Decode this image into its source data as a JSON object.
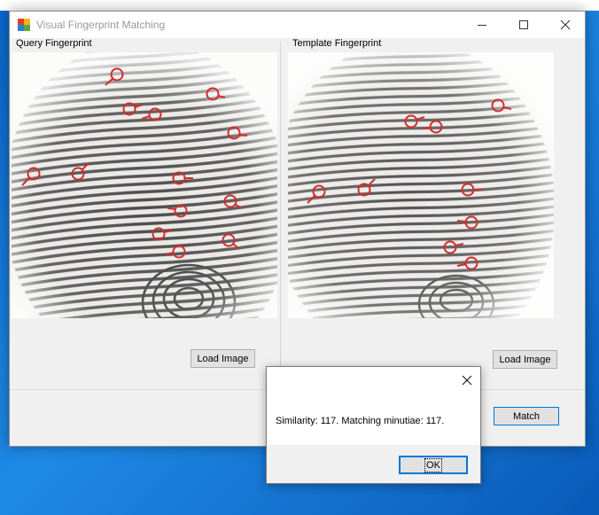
{
  "window": {
    "title": "Visual Fingerprint Matching",
    "icon": "app-icon",
    "controls": [
      "minimize-icon",
      "maximize-icon",
      "close-icon"
    ]
  },
  "query_panel": {
    "label": "Query Fingerprint",
    "load_label": "Load Image"
  },
  "template_panel": {
    "label": "Template Fingerprint",
    "load_label": "Load Image"
  },
  "match_label": "Match",
  "dialog": {
    "message": "Similarity: 117. Matching minutiae: 117.",
    "ok_label": "OK",
    "close_icon": "close-icon"
  },
  "colors": {
    "minutia_marker": "#d62b2b",
    "accent": "#0078d7",
    "desktop": "#1273d6"
  }
}
